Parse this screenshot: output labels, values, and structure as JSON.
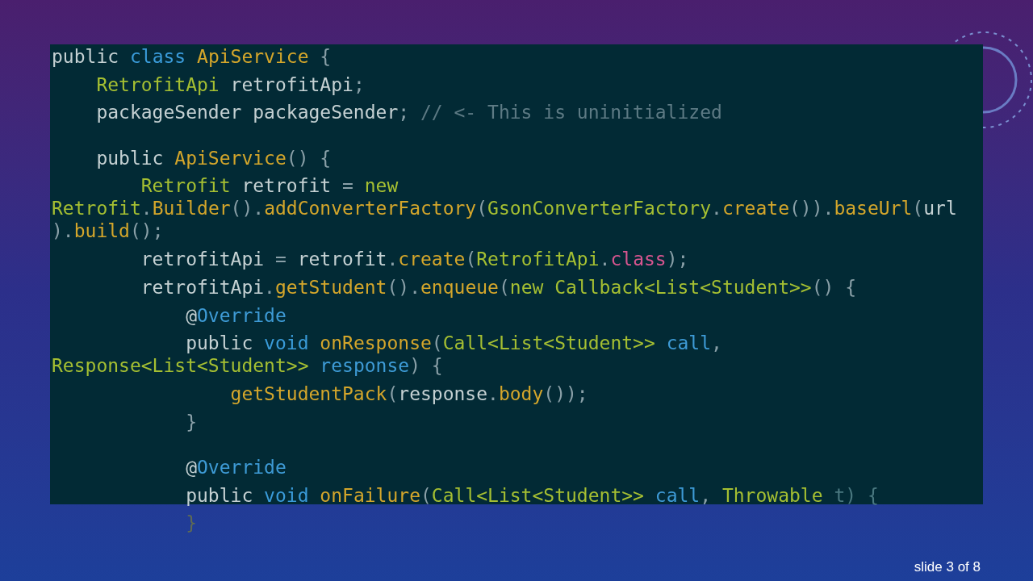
{
  "code_lines": [
    {
      "kind": "code",
      "visual_lines": [
        [
          {
            "text": "public ",
            "kind": "plain"
          },
          {
            "text": "class ",
            "kind": "keyword"
          },
          {
            "text": "ApiService",
            "kind": "method"
          },
          {
            "text": " {",
            "kind": "punct"
          }
        ]
      ]
    },
    {
      "kind": "code",
      "visual_lines": [
        [
          {
            "text": "    RetrofitApi",
            "kind": "type"
          },
          {
            "text": " retrofitApi",
            "kind": "plain"
          },
          {
            "text": ";",
            "kind": "punct"
          }
        ]
      ]
    },
    {
      "kind": "code",
      "visual_lines": [
        [
          {
            "text": "    packageSender packageSender",
            "kind": "plain"
          },
          {
            "text": ";",
            "kind": "punct"
          },
          {
            "text": " // <- This is uninitialized",
            "kind": "comment"
          }
        ]
      ]
    },
    {
      "kind": "blank"
    },
    {
      "kind": "code",
      "visual_lines": [
        [
          {
            "text": "    public ",
            "kind": "plain"
          },
          {
            "text": "ApiService",
            "kind": "method"
          },
          {
            "text": "() {",
            "kind": "punct"
          }
        ]
      ]
    },
    {
      "kind": "code",
      "visual_lines": [
        [
          {
            "text": "        Retrofit",
            "kind": "type"
          },
          {
            "text": " retrofit ",
            "kind": "plain"
          },
          {
            "text": "= ",
            "kind": "punct"
          },
          {
            "text": "new",
            "kind": "type"
          }
        ],
        [
          {
            "text": "Retrofit",
            "kind": "type"
          },
          {
            "text": ".",
            "kind": "punct"
          },
          {
            "text": "Builder",
            "kind": "method"
          },
          {
            "text": "().",
            "kind": "punct"
          },
          {
            "text": "addConverterFactory",
            "kind": "method"
          },
          {
            "text": "(",
            "kind": "punct"
          },
          {
            "text": "GsonConverterFactory",
            "kind": "type"
          },
          {
            "text": ".",
            "kind": "punct"
          },
          {
            "text": "create",
            "kind": "method"
          },
          {
            "text": "()).",
            "kind": "punct"
          },
          {
            "text": "baseUrl",
            "kind": "method"
          },
          {
            "text": "(",
            "kind": "punct"
          },
          {
            "text": "url",
            "kind": "plain"
          }
        ],
        [
          {
            "text": ").",
            "kind": "punct"
          },
          {
            "text": "build",
            "kind": "method"
          },
          {
            "text": "();",
            "kind": "punct"
          }
        ]
      ]
    },
    {
      "kind": "code",
      "visual_lines": [
        [
          {
            "text": "        retrofitApi ",
            "kind": "plain"
          },
          {
            "text": "=",
            "kind": "punct"
          },
          {
            "text": " retrofit",
            "kind": "plain"
          },
          {
            "text": ".",
            "kind": "punct"
          },
          {
            "text": "create",
            "kind": "method"
          },
          {
            "text": "(",
            "kind": "punct"
          },
          {
            "text": "RetrofitApi",
            "kind": "type"
          },
          {
            "text": ".",
            "kind": "punct"
          },
          {
            "text": "class",
            "kind": "special"
          },
          {
            "text": ");",
            "kind": "punct"
          }
        ]
      ]
    },
    {
      "kind": "code",
      "visual_lines": [
        [
          {
            "text": "        retrofitApi",
            "kind": "plain"
          },
          {
            "text": ".",
            "kind": "punct"
          },
          {
            "text": "getStudent",
            "kind": "method"
          },
          {
            "text": "().",
            "kind": "punct"
          },
          {
            "text": "enqueue",
            "kind": "method"
          },
          {
            "text": "(",
            "kind": "punct"
          },
          {
            "text": "new Callback<List<Student>>",
            "kind": "type"
          },
          {
            "text": "() {",
            "kind": "punct"
          }
        ]
      ]
    },
    {
      "kind": "code",
      "visual_lines": [
        [
          {
            "text": "            @",
            "kind": "plain"
          },
          {
            "text": "Override",
            "kind": "param"
          }
        ]
      ]
    },
    {
      "kind": "code",
      "visual_lines": [
        [
          {
            "text": "            public ",
            "kind": "plain"
          },
          {
            "text": "void ",
            "kind": "keyword"
          },
          {
            "text": "onResponse",
            "kind": "method"
          },
          {
            "text": "(",
            "kind": "punct"
          },
          {
            "text": "Call<List<Student>> ",
            "kind": "type"
          },
          {
            "text": "call",
            "kind": "param"
          },
          {
            "text": ",",
            "kind": "punct"
          }
        ],
        [
          {
            "text": "Response<List<Student>> ",
            "kind": "type"
          },
          {
            "text": "response",
            "kind": "param"
          },
          {
            "text": ") {",
            "kind": "punct"
          }
        ]
      ]
    },
    {
      "kind": "code",
      "visual_lines": [
        [
          {
            "text": "                getStudentPack",
            "kind": "method"
          },
          {
            "text": "(",
            "kind": "punct"
          },
          {
            "text": "response",
            "kind": "plain"
          },
          {
            "text": ".",
            "kind": "punct"
          },
          {
            "text": "body",
            "kind": "method"
          },
          {
            "text": "());",
            "kind": "punct"
          }
        ]
      ]
    },
    {
      "kind": "code",
      "visual_lines": [
        [
          {
            "text": "            }",
            "kind": "punct"
          }
        ]
      ]
    },
    {
      "kind": "blank"
    },
    {
      "kind": "code",
      "visual_lines": [
        [
          {
            "text": "            @",
            "kind": "plain"
          },
          {
            "text": "Override",
            "kind": "param"
          }
        ]
      ]
    },
    {
      "kind": "code",
      "visual_lines": [
        [
          {
            "text": "            public ",
            "kind": "plain"
          },
          {
            "text": "void ",
            "kind": "keyword"
          },
          {
            "text": "onFailure",
            "kind": "method"
          },
          {
            "text": "(",
            "kind": "punct"
          },
          {
            "text": "Call<List<Student>> ",
            "kind": "type"
          },
          {
            "text": "call",
            "kind": "param"
          },
          {
            "text": ", ",
            "kind": "punct"
          },
          {
            "text": "Throwable ",
            "kind": "type"
          },
          {
            "text": "t) {",
            "kind": "faded"
          }
        ]
      ]
    },
    {
      "kind": "code",
      "visual_lines": [
        [
          {
            "text": "            }",
            "kind": "dim"
          }
        ]
      ]
    }
  ],
  "slide_counter": "slide 3 of 8"
}
